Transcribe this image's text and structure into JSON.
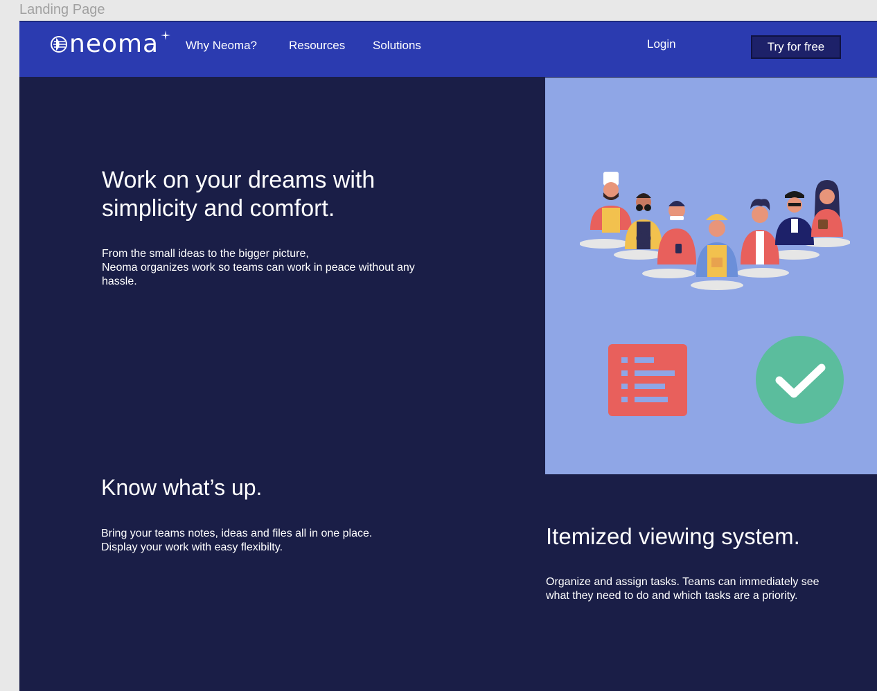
{
  "frame": {
    "label": "Landing Page"
  },
  "header": {
    "logo_text": "neoma",
    "nav": {
      "why": "Why Neoma?",
      "resources": "Resources",
      "solutions": "Solutions",
      "login": "Login",
      "cta": "Try for free"
    }
  },
  "hero": {
    "title": "Work on your dreams with simplicity and comfort.",
    "body_lines": [
      "From the small ideas to the bigger picture,",
      "Neoma organizes work so teams can work in peace without any hassle."
    ]
  },
  "illustration": {
    "icons": [
      "team-of-workers-icon",
      "task-list-icon",
      "checkmark-icon"
    ],
    "colors": {
      "panel": "#8fa6e6",
      "list_card": "#e8605c",
      "check_circle": "#5bbd9d"
    }
  },
  "section_know": {
    "title": "Know what’s up.",
    "body_lines": [
      "Bring your teams notes, ideas and files all in one place.",
      "Display your work with easy flexibilty."
    ]
  },
  "section_itemized": {
    "title": "Itemized viewing system.",
    "body_lines": [
      "Organize and assign tasks. Teams can immediately see",
      "what they need to do and which tasks are a priority."
    ]
  },
  "colors": {
    "page_bg": "#1a1e47",
    "navbar": "#2b3bb0",
    "cta_bg": "#1d2169"
  }
}
